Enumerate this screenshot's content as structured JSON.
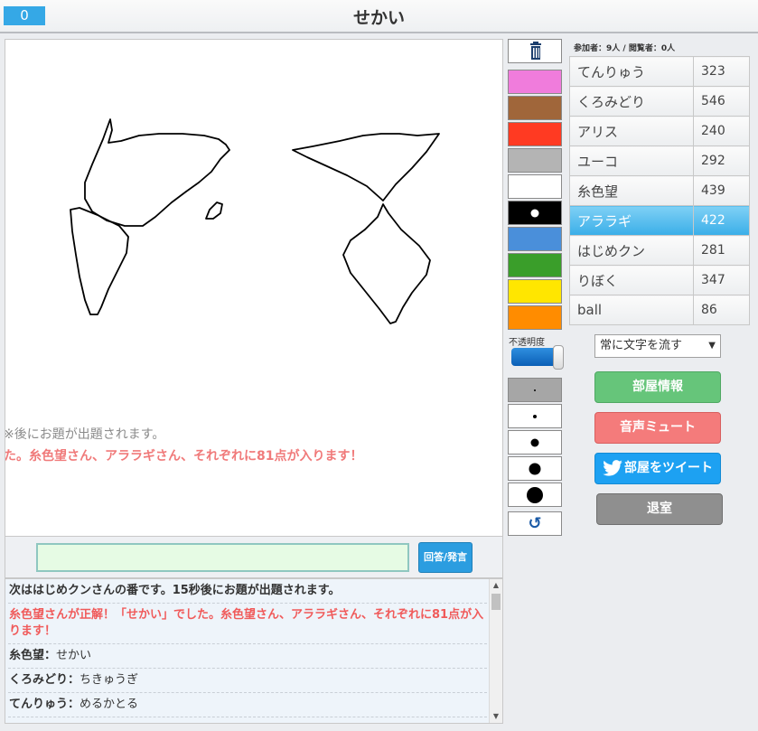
{
  "header": {
    "counter": "0",
    "title": "せかい"
  },
  "canvas": {
    "flow_line_1": "※後にお題が出題されます。",
    "flow_line_2": "た。糸色望さん、アララギさん、それぞれに81点が入ります！"
  },
  "input": {
    "value": "",
    "button_label": "回答/発言"
  },
  "chat": [
    {
      "name": "",
      "text": "次ははじめクンさんの番です。15秒後にお題が出題されます。",
      "style": "bold"
    },
    {
      "name": "",
      "text": "糸色望さんが正解！「せかい」でした。糸色望さん、アララギさん、それぞれに81点が入ります！",
      "style": "red"
    },
    {
      "name": "糸色望：",
      "text": "せかい",
      "style": "normal"
    },
    {
      "name": "くろみどり：",
      "text": "ちきゅうぎ",
      "style": "normal"
    },
    {
      "name": "てんりゅう：",
      "text": "めるかとる",
      "style": "normal"
    }
  ],
  "palette": {
    "colors": [
      "#f07cdc",
      "#a0663a",
      "#ff3a22",
      "#b4b4b4",
      "#ffffff",
      "#000000",
      "#4a8fda",
      "#3a9e2a",
      "#ffe600",
      "#ff8c00"
    ],
    "selected_index": 5,
    "opacity_label": "不透明度",
    "opacity_value": 1.0,
    "pen_sizes_selected_index": 0
  },
  "room": {
    "participants_text": "参加者：9人 / 閲覧者：0人",
    "players": [
      {
        "name": "てんりゅう",
        "score": "323",
        "active": false
      },
      {
        "name": "くろみどり",
        "score": "546",
        "active": false
      },
      {
        "name": "アリス",
        "score": "240",
        "active": false
      },
      {
        "name": "ユーコ",
        "score": "292",
        "active": false
      },
      {
        "name": "糸色望",
        "score": "439",
        "active": false
      },
      {
        "name": "アララギ",
        "score": "422",
        "active": true
      },
      {
        "name": "はじめクン",
        "score": "281",
        "active": false
      },
      {
        "name": "りぼく",
        "score": "347",
        "active": false
      },
      {
        "name": "ball",
        "score": "86",
        "active": false
      }
    ],
    "scroll_mode": "常に文字を流す",
    "buttons": {
      "info": "部屋情報",
      "mute": "音声ミュート",
      "tweet": "部屋をツイート",
      "exit": "退室"
    }
  }
}
